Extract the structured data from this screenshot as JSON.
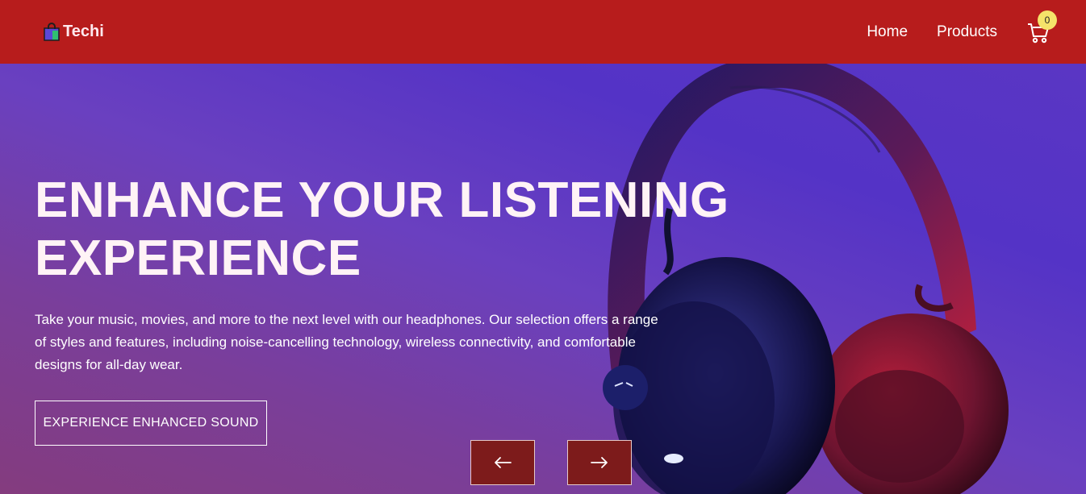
{
  "navbar": {
    "brand": "Techi",
    "links": [
      "Home",
      "Products"
    ],
    "cart_count": "0",
    "icons": [
      "shopping-bag-icon",
      "cart-icon"
    ]
  },
  "hero": {
    "title_line1": "ENHANCE YOUR LISTENING",
    "title_line2": "EXPERIENCE",
    "description": "Take your music, movies, and more to the next level with our headphones. Our selection offers a range of styles and features, including noise-cancelling technology, wireless connectivity, and comfortable designs for all-day wear.",
    "cta_label": "EXPERIENCE ENHANCED SOUND",
    "image": "headphones-image",
    "controls": [
      "arrow-left-icon",
      "arrow-right-icon"
    ]
  },
  "colors": {
    "navbar": "#b71c1c",
    "cart_badge": "#f5e36a",
    "arrow_button": "#7d1b1b"
  }
}
